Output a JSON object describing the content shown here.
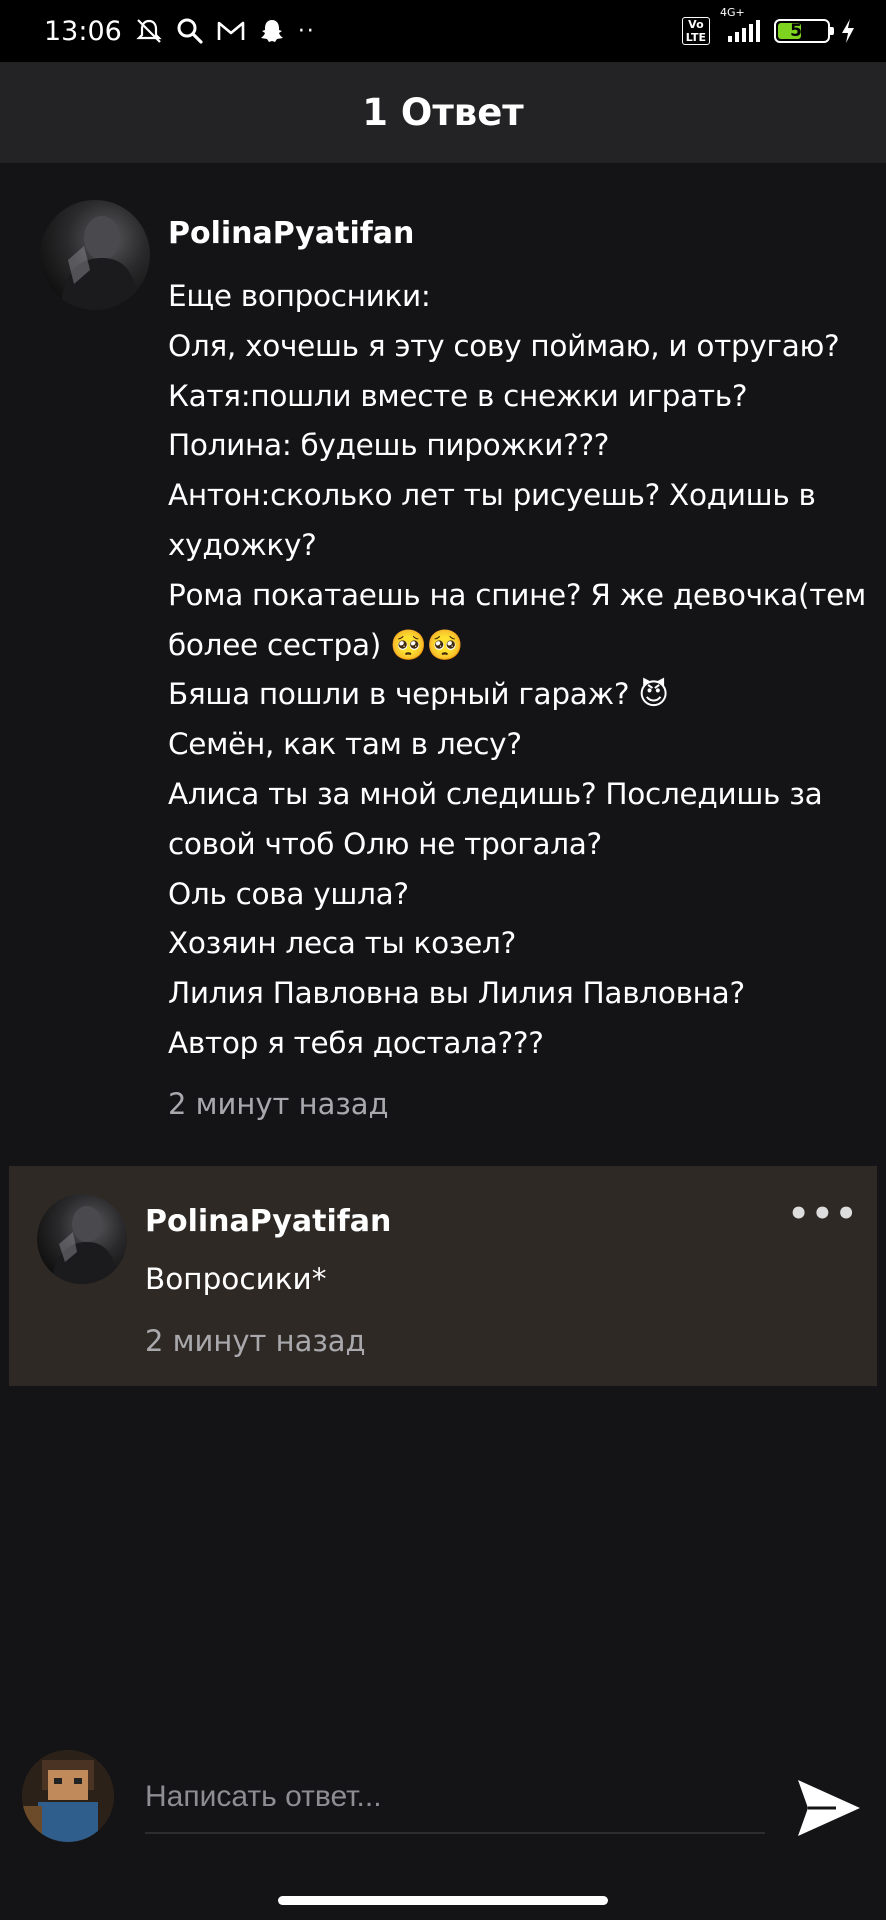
{
  "status_bar": {
    "time": "13:06",
    "icons_left": [
      "mute-icon",
      "search-icon",
      "mail-icon",
      "snapchat-icon",
      "more-dots-icon"
    ],
    "network_label": "4G+",
    "volte_label": "Vo LTE",
    "battery_level": "52",
    "battery_percent": 52
  },
  "header": {
    "title": "1 Ответ"
  },
  "comment": {
    "username": "PolinaPyatifan",
    "text": "Еще вопросники:\nОля, хочешь я эту сову поймаю, и отругаю?\nКатя:пошли вместе в снежки играть?\nПолина: будешь пирожки???\nАнтон:сколько лет ты рисуешь?  Ходишь в художку?\nРома покатаешь на спине? Я же девочка(тем более сестра) 🥺🥺\nБяша пошли в черный гараж? 😈\nСемён, как там в лесу?\nАлиса ты за мной следишь? Последишь за совой чтоб Олю не трогала?\nОль сова ушла?\nХозяин леса ты козел?\nЛилия Павловна вы Лилия Павловна?\nАвтор я тебя достала???",
    "time": "2 минут назад"
  },
  "reply": {
    "username": "PolinaPyatifan",
    "text": "Вопросики*",
    "time": "2 минут назад",
    "more_label": "•••"
  },
  "composer": {
    "placeholder": "Написать ответ...",
    "send_icon": "send-icon"
  },
  "colors": {
    "background": "#141316",
    "header_bg": "#232325",
    "reply_bg": "#2f2925",
    "muted_text": "#a9a9ad",
    "battery_green": "#7ed321"
  }
}
